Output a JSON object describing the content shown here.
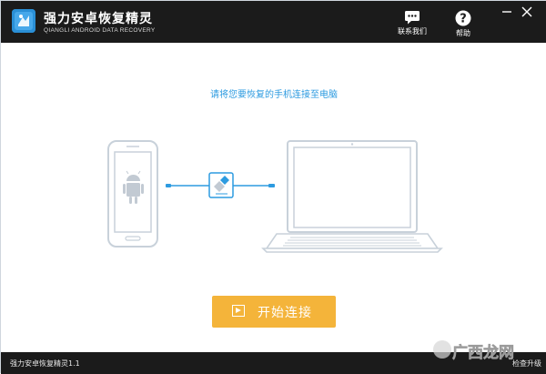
{
  "app": {
    "title": "强力安卓恢复精灵",
    "subtitle": "QIANGLI ANDROID DATA RECOVERY"
  },
  "toolbar": {
    "contact_label": "联系我们",
    "help_label": "帮助"
  },
  "main": {
    "instruction": "请将您要恢复的手机连接至电脑",
    "start_button_label": "开始连接"
  },
  "statusbar": {
    "version": "强力安卓恢复精灵1.1",
    "update_link": "检查升级"
  },
  "watermark": {
    "text": "广西龙网"
  },
  "colors": {
    "titlebar": "#1b1b1b",
    "accent_blue": "#2d9be0",
    "start_button": "#f4b43a",
    "device_stroke": "#c8d1da"
  },
  "icons": [
    "app-logo-icon",
    "chat-icon",
    "help-icon",
    "minimize-icon",
    "close-icon",
    "android-robot-icon",
    "usb-connector-icon",
    "play-icon"
  ]
}
